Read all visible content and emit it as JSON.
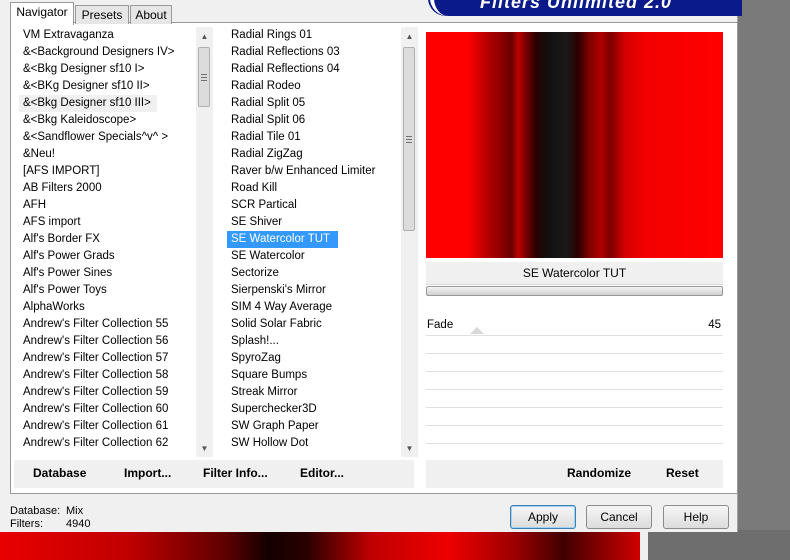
{
  "banner": {
    "title": "Filters Unlimited 2.0"
  },
  "tabs": [
    {
      "label": "Navigator",
      "active": true
    },
    {
      "label": "Presets",
      "active": false
    },
    {
      "label": "About",
      "active": false
    }
  ],
  "categories": {
    "items": [
      " VM Extravaganza",
      "&<Background Designers IV>",
      "&<Bkg Designer sf10 I>",
      "&<BKg Designer sf10 II>",
      "&<Bkg Designer sf10 III>",
      "&<Bkg Kaleidoscope>",
      "&<Sandflower Specials^v^ >",
      "&Neu!",
      "[AFS IMPORT]",
      "AB Filters 2000",
      "AFH",
      "AFS import",
      "Alf's Border FX",
      "Alf's Power Grads",
      "Alf's Power Sines",
      "Alf's Power Toys",
      "AlphaWorks",
      "Andrew's Filter Collection 55",
      "Andrew's Filter Collection 56",
      "Andrew's Filter Collection 57",
      "Andrew's Filter Collection 58",
      "Andrew's Filter Collection 59",
      "Andrew's Filter Collection 60",
      "Andrew's Filter Collection 61",
      "Andrew's Filter Collection 62"
    ],
    "selected_index": 4
  },
  "filters": {
    "items": [
      "Radial  Rings 01",
      "Radial Reflections 03",
      "Radial Reflections 04",
      "Radial Rodeo",
      "Radial Split 05",
      "Radial Split 06",
      "Radial Tile 01",
      "Radial ZigZag",
      "Raver b/w Enhanced Limiter",
      "Road Kill",
      "SCR  Partical",
      "SE Shiver",
      "SE Watercolor TUT",
      "SE Watercolor",
      "Sectorize",
      "Sierpenski's Mirror",
      "SIM 4 Way Average",
      "Solid Solar Fabric",
      "Splash!...",
      "SpyroZag",
      "Square Bumps",
      "Streak Mirror",
      "Superchecker3D",
      "SW Graph Paper",
      "SW Hollow Dot"
    ],
    "selected_index": 12
  },
  "preview": {
    "filter_name": "SE Watercolor TUT"
  },
  "params": [
    {
      "label": "Fade",
      "value": "45"
    }
  ],
  "toolbar": {
    "database": "Database",
    "import": "Import...",
    "filter_info": "Filter Info...",
    "editor": "Editor...",
    "randomize": "Randomize",
    "reset": "Reset"
  },
  "status": {
    "database_label": "Database:",
    "database_value": "Mix",
    "filters_label": "Filters:",
    "filters_value": "4940"
  },
  "buttons": {
    "apply": "Apply",
    "cancel": "Cancel",
    "help": "Help"
  },
  "colors": {
    "selection": "#3399ff",
    "banner": "#0a1a8a"
  }
}
